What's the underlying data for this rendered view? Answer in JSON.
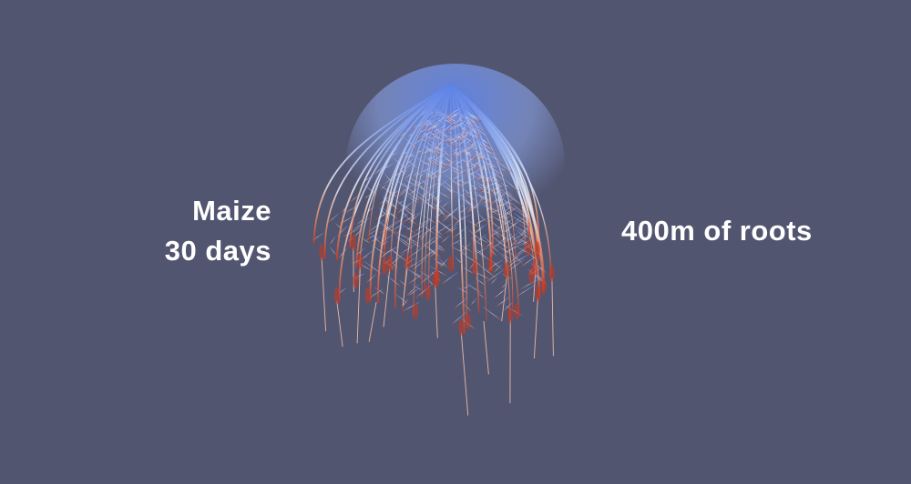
{
  "caption": {
    "species": "Maize",
    "age": "30 days",
    "root_length": "400m of roots"
  },
  "colors": {
    "background": "#525570",
    "text": "#ffffff",
    "root_young": "#6f8fe8",
    "root_mid": "#e8eefc",
    "root_old": "#d9603f",
    "root_tip": "#c42a1a"
  }
}
